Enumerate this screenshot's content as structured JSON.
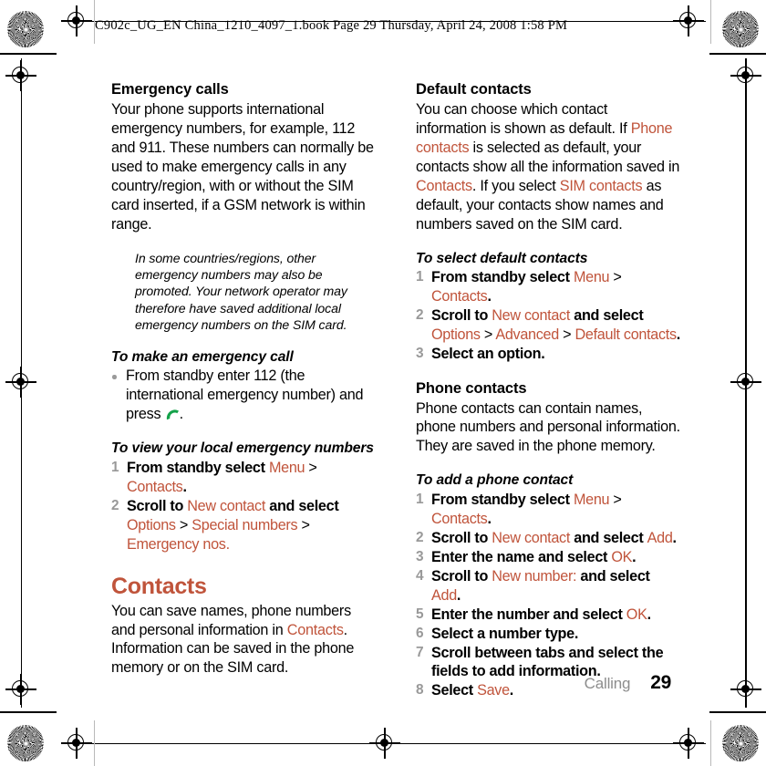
{
  "header": {
    "text": "C902c_UG_EN China_1210_4097_1.book  Page 29  Thursday, April 24, 2008  1:58 PM"
  },
  "accent_color": "#C0543B",
  "left_column": {
    "emergency_calls": {
      "heading": "Emergency calls",
      "body": "Your phone supports international emergency numbers, for example, 112 and 911. These numbers can normally be used to make emergency calls in any country/region, with or without the SIM card inserted, if a GSM network is within range."
    },
    "note": {
      "icon": "exclamation-icon",
      "text": "In some countries/regions, other emergency numbers may also be promoted. Your network operator may therefore have saved additional local emergency numbers on the SIM card."
    },
    "make_emergency_call": {
      "heading": "To make an emergency call",
      "bullet_prefix": "From standby enter 112 (the international emergency number) and press ",
      "bullet_icon": "call-icon",
      "bullet_suffix": "."
    },
    "view_local_numbers": {
      "heading": "To view your local emergency numbers",
      "steps": [
        {
          "segments": [
            {
              "text": "From standby select ",
              "style": "plain"
            },
            {
              "text": "Menu",
              "style": "ui"
            },
            {
              "text": " > ",
              "style": "sep"
            },
            {
              "text": "Contacts",
              "style": "ui"
            },
            {
              "text": ".",
              "style": "plain"
            }
          ]
        },
        {
          "segments": [
            {
              "text": "Scroll to ",
              "style": "plain"
            },
            {
              "text": "New contact",
              "style": "ui"
            },
            {
              "text": " and select ",
              "style": "plain"
            },
            {
              "text": "Options",
              "style": "ui"
            },
            {
              "text": " > ",
              "style": "sep"
            },
            {
              "text": "Special numbers",
              "style": "ui"
            },
            {
              "text": " > ",
              "style": "sep"
            },
            {
              "text": "Emergency nos.",
              "style": "ui"
            }
          ]
        }
      ]
    },
    "contacts": {
      "heading": "Contacts",
      "body_before": "You can save names, phone numbers and personal information in ",
      "body_ui": "Contacts",
      "body_after": ". Information can be saved in the phone memory or on the SIM card."
    }
  },
  "right_column": {
    "default_contacts": {
      "heading": "Default contacts",
      "segments": [
        {
          "text": "You can choose which contact information is shown as default. If ",
          "style": "plain"
        },
        {
          "text": "Phone contacts",
          "style": "ui"
        },
        {
          "text": " is selected as default, your contacts show all the information saved in ",
          "style": "plain"
        },
        {
          "text": "Contacts",
          "style": "ui"
        },
        {
          "text": ". If you select ",
          "style": "plain"
        },
        {
          "text": "SIM contacts",
          "style": "ui"
        },
        {
          "text": " as default, your contacts show names and numbers saved on the SIM card.",
          "style": "plain"
        }
      ]
    },
    "select_default_contacts": {
      "heading": "To select default contacts",
      "steps": [
        {
          "segments": [
            {
              "text": "From standby select ",
              "style": "plain"
            },
            {
              "text": "Menu",
              "style": "ui"
            },
            {
              "text": " > ",
              "style": "sep"
            },
            {
              "text": "Contacts",
              "style": "ui"
            },
            {
              "text": ".",
              "style": "plain"
            }
          ]
        },
        {
          "segments": [
            {
              "text": "Scroll to ",
              "style": "plain"
            },
            {
              "text": "New contact",
              "style": "ui"
            },
            {
              "text": " and select ",
              "style": "plain"
            },
            {
              "text": "Options",
              "style": "ui"
            },
            {
              "text": " > ",
              "style": "sep"
            },
            {
              "text": "Advanced",
              "style": "ui"
            },
            {
              "text": " > ",
              "style": "sep"
            },
            {
              "text": "Default contacts",
              "style": "ui"
            },
            {
              "text": ".",
              "style": "plain"
            }
          ]
        },
        {
          "segments": [
            {
              "text": "Select an option.",
              "style": "plain"
            }
          ]
        }
      ]
    },
    "phone_contacts": {
      "heading": "Phone contacts",
      "body": "Phone contacts can contain names, phone numbers and personal information. They are saved in the phone memory."
    },
    "add_phone_contact": {
      "heading": "To add a phone contact",
      "steps": [
        {
          "segments": [
            {
              "text": "From standby select ",
              "style": "plain"
            },
            {
              "text": "Menu",
              "style": "ui"
            },
            {
              "text": " > ",
              "style": "sep"
            },
            {
              "text": "Contacts",
              "style": "ui"
            },
            {
              "text": ".",
              "style": "plain"
            }
          ]
        },
        {
          "segments": [
            {
              "text": "Scroll to ",
              "style": "plain"
            },
            {
              "text": "New contact",
              "style": "ui"
            },
            {
              "text": " and select ",
              "style": "plain"
            },
            {
              "text": "Add",
              "style": "ui"
            },
            {
              "text": ".",
              "style": "plain"
            }
          ]
        },
        {
          "segments": [
            {
              "text": "Enter the name and select ",
              "style": "plain"
            },
            {
              "text": "OK",
              "style": "ui"
            },
            {
              "text": ".",
              "style": "plain"
            }
          ]
        },
        {
          "segments": [
            {
              "text": "Scroll to ",
              "style": "plain"
            },
            {
              "text": "New number:",
              "style": "ui"
            },
            {
              "text": " and select ",
              "style": "plain"
            },
            {
              "text": "Add",
              "style": "ui"
            },
            {
              "text": ".",
              "style": "plain"
            }
          ]
        },
        {
          "segments": [
            {
              "text": "Enter the number and select ",
              "style": "plain"
            },
            {
              "text": "OK",
              "style": "ui"
            },
            {
              "text": ".",
              "style": "plain"
            }
          ]
        },
        {
          "segments": [
            {
              "text": "Select a number type.",
              "style": "plain"
            }
          ]
        },
        {
          "segments": [
            {
              "text": "Scroll between tabs and select the fields to add information.",
              "style": "plain"
            }
          ]
        },
        {
          "segments": [
            {
              "text": "Select ",
              "style": "plain"
            },
            {
              "text": "Save",
              "style": "ui"
            },
            {
              "text": ".",
              "style": "plain"
            }
          ]
        }
      ]
    }
  },
  "footer": {
    "chapter": "Calling",
    "page_number": "29"
  }
}
